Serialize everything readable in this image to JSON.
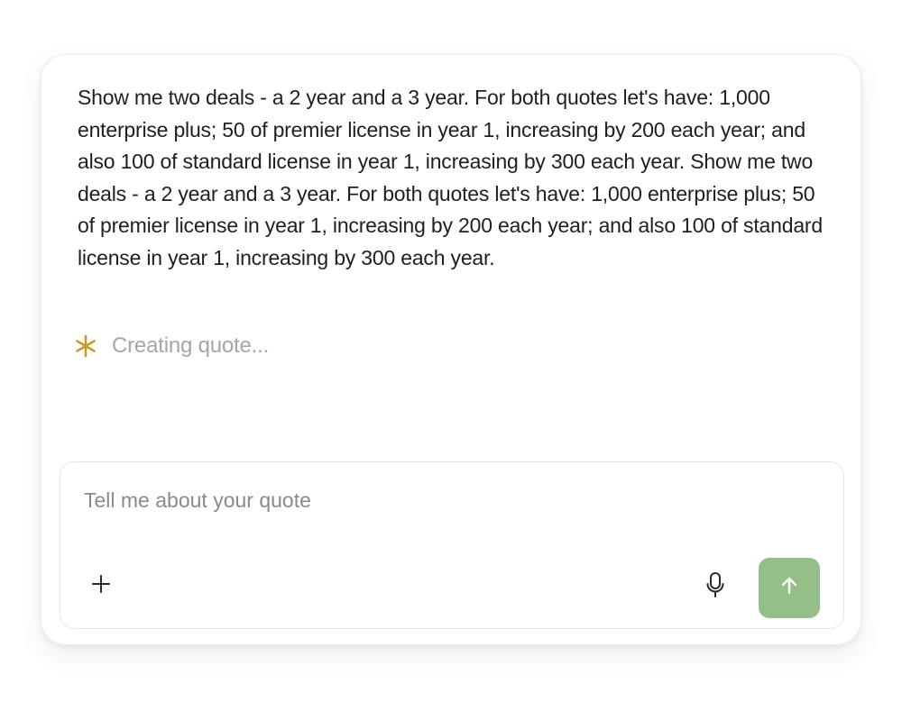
{
  "conversation": {
    "user_message": "Show me two deals - a 2 year and a 3 year. For both quotes let's have: 1,000 enterprise plus; 50 of premier license in year 1, increasing by 200 each year; and also 100 of standard license in year 1, increasing by 300 each year. Show me two deals - a 2 year and a 3 year. For both quotes let's have: 1,000 enterprise plus; 50 of premier license in year 1, increasing by 200 each year; and also 100 of standard license in year 1, increasing by 300 each year.",
    "status": {
      "icon": "asterisk-spinner-icon",
      "text": "Creating quote...",
      "color": "#c89a2e"
    }
  },
  "composer": {
    "placeholder": "Tell me about your quote",
    "value": "",
    "add_icon": "plus-icon",
    "mic_icon": "microphone-icon",
    "send_icon": "arrow-up-icon",
    "send_color": "#94bf89"
  }
}
